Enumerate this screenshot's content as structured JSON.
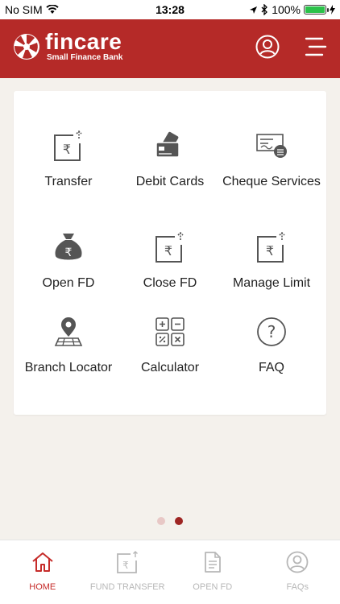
{
  "status_bar": {
    "carrier": "No SIM",
    "time": "13:28",
    "battery": "100%",
    "battery_level": 1.0
  },
  "header": {
    "brand_name": "fincare",
    "brand_tagline": "Small Finance Bank"
  },
  "grid": {
    "transfer": "Transfer",
    "debit_cards": "Debit Cards",
    "cheque_services": "Cheque Services",
    "open_fd": "Open FD",
    "close_fd": "Close FD",
    "manage_limit": "Manage Limit",
    "branch_locator": "Branch Locator",
    "calculator": "Calculator",
    "faq": "FAQ"
  },
  "pager": {
    "pages": 2,
    "active": 2
  },
  "tabs": [
    {
      "label": "HOME",
      "icon": "home-icon",
      "active": true
    },
    {
      "label": "FUND TRANSFER",
      "icon": "fund-transfer-icon",
      "active": false
    },
    {
      "label": "OPEN FD",
      "icon": "document-icon",
      "active": false
    },
    {
      "label": "FAQs",
      "icon": "user-circle-icon",
      "active": false
    }
  ],
  "colors": {
    "brand": "#b52a28",
    "active_tab": "#c62c2a",
    "icon_gray": "#555555",
    "background": "#f4f1ec"
  }
}
